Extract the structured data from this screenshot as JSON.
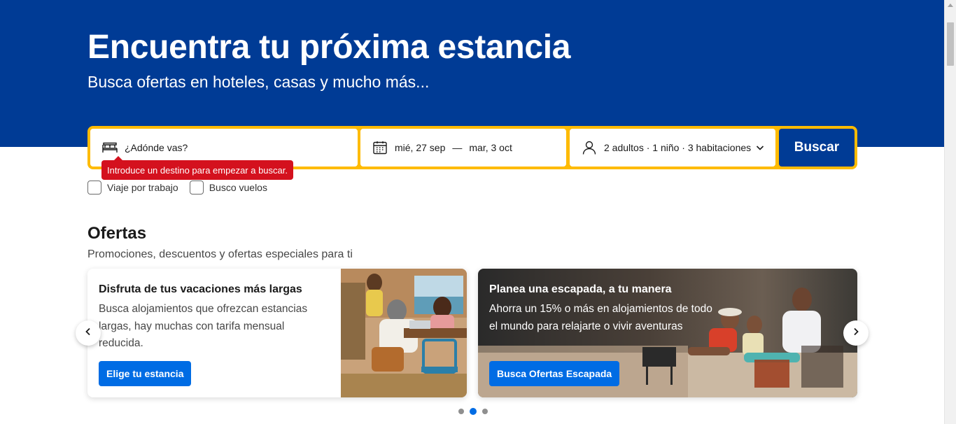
{
  "hero": {
    "title": "Encuentra tu próxima estancia",
    "subtitle": "Busca ofertas en hoteles, casas y mucho más..."
  },
  "search": {
    "destination_placeholder": "¿Adónde vas?",
    "checkin": "mié, 27 sep",
    "date_separator": "—",
    "checkout": "mar, 3 oct",
    "guests": "2 adultos · 1 niño · 3 habitaciones",
    "button": "Buscar",
    "error_tooltip": "Introduce un destino para empezar a buscar."
  },
  "options": {
    "business_trip": "Viaje por trabajo",
    "flights": "Busco vuelos"
  },
  "offers": {
    "title": "Ofertas",
    "subtitle": "Promociones, descuentos y ofertas especiales para ti",
    "cards": [
      {
        "title": "Disfruta de tus vacaciones más largas",
        "body": "Busca alojamientos que ofrezcan estancias largas, hay muchas con tarifa mensual reducida.",
        "button": "Elige tu estancia"
      },
      {
        "title": "Planea una escapada, a tu manera",
        "body": "Ahorra un 15% o más en alojamientos de todo el mundo para relajarte o vivir aventuras",
        "button": "Busca Ofertas Escapada"
      }
    ],
    "carousel": {
      "pages": 3,
      "active_page": 2
    }
  },
  "colors": {
    "brand": "#003b95",
    "accent": "#febb02",
    "cta": "#006ce4",
    "error": "#d4111e"
  },
  "icons": [
    "bed-icon",
    "calendar-icon",
    "person-icon",
    "chevron-down-icon",
    "chevron-left-icon",
    "chevron-right-icon"
  ]
}
